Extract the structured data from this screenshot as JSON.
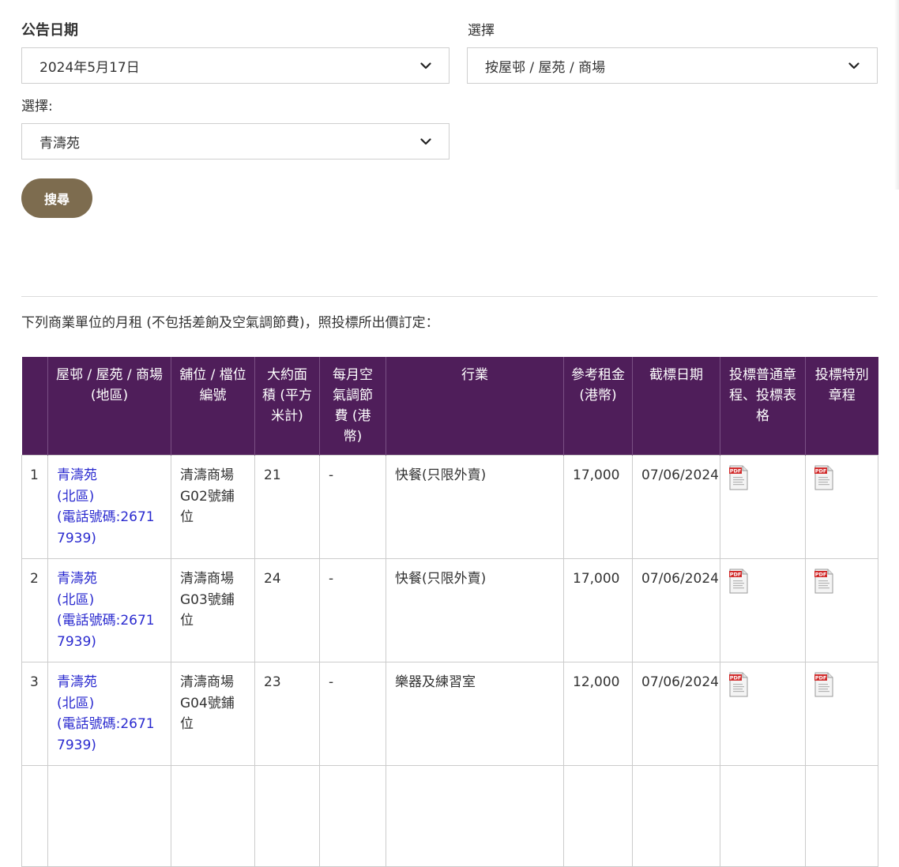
{
  "filters": {
    "date_label": "公告日期",
    "date_value": "2024年5月17日",
    "type_label": "選擇",
    "type_value": "按屋邨 / 屋苑 / 商場",
    "estate_label": "選擇:",
    "estate_value": "青濤苑",
    "search_label": "搜尋"
  },
  "note": "下列商業單位的月租 (不包括差餉及空氣調節費)，照投標所出價訂定：",
  "table": {
    "headers": [
      "",
      "屋邨 / 屋苑 / 商場 (地區)",
      "舖位 / 檔位編號",
      "大約面積 (平方米計)",
      "每月空氣調節費 (港幣)",
      "行業",
      "參考租金 (港幣)",
      "截標日期",
      "投標普通章程、投標表格",
      "投標特別章程"
    ],
    "rows": [
      {
        "no": "1",
        "estate": "青濤苑",
        "district": "(北區)",
        "phone": "(電話號碼:26717939)",
        "shop": "清濤商場G02號鋪位",
        "area": "21",
        "ac": "-",
        "trade": "快餐(只限外賣)",
        "rent": "17,000",
        "closing": "07/06/2024"
      },
      {
        "no": "2",
        "estate": "青濤苑",
        "district": "(北區)",
        "phone": "(電話號碼:26717939)",
        "shop": "清濤商場G03號鋪位",
        "area": "24",
        "ac": "-",
        "trade": "快餐(只限外賣)",
        "rent": "17,000",
        "closing": "07/06/2024"
      },
      {
        "no": "3",
        "estate": "青濤苑",
        "district": "(北區)",
        "phone": "(電話號碼:26717939)",
        "shop": "清濤商場G04號鋪位",
        "area": "23",
        "ac": "-",
        "trade": "樂器及練習室",
        "rent": "12,000",
        "closing": "07/06/2024"
      },
      {
        "no": "",
        "estate": "",
        "district": "",
        "phone": "",
        "shop": "",
        "area": "",
        "ac": "",
        "trade": "",
        "rent": "",
        "closing": ""
      }
    ]
  },
  "colors": {
    "header_bg": "#4f1e5a",
    "button_bg": "#7d6c4f",
    "link": "#2a2acf"
  },
  "icons": {
    "dropdown": "chevron-down-icon",
    "pdf": "pdf-icon"
  }
}
